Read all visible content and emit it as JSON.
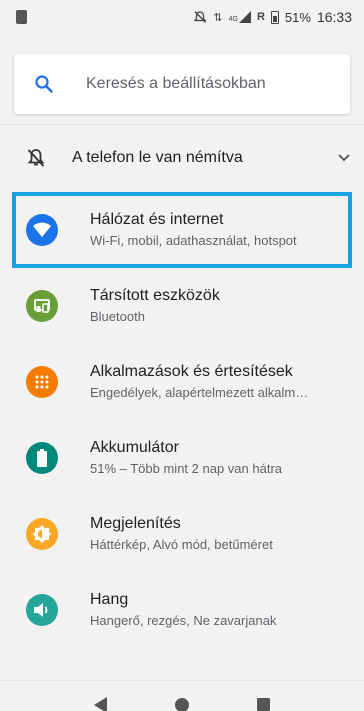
{
  "status_bar": {
    "signal_label": "4G",
    "roaming": "R",
    "battery_percent": "51%",
    "time": "16:33"
  },
  "search": {
    "placeholder": "Keresés a beállításokban"
  },
  "silent_banner": {
    "label": "A telefon le van némítva"
  },
  "settings_items": [
    {
      "title": "Hálózat és internet",
      "subtitle": "Wi-Fi, mobil, adathasználat, hotspot",
      "icon": "wifi-icon",
      "color": "#1a73e8"
    },
    {
      "title": "Társított eszközök",
      "subtitle": "Bluetooth",
      "icon": "devices-icon",
      "color": "#689f38"
    },
    {
      "title": "Alkalmazások és értesítések",
      "subtitle": "Engedélyek, alapértelmezett alkalm…",
      "icon": "apps-grid-icon",
      "color": "#f57c00"
    },
    {
      "title": "Akkumulátor",
      "subtitle": "51% – Több mint 2 nap van hátra",
      "icon": "battery-icon",
      "color": "#00897b"
    },
    {
      "title": "Megjelenítés",
      "subtitle": "Háttérkép, Alvó mód, betűméret",
      "icon": "brightness-icon",
      "color": "#f9a825"
    },
    {
      "title": "Hang",
      "subtitle": "Hangerő, rezgés, Ne zavarjanak",
      "icon": "volume-icon",
      "color": "#26a69a"
    }
  ],
  "colors": {
    "highlight_border": "#1aa1e6",
    "search_accent": "#1a73e8"
  }
}
